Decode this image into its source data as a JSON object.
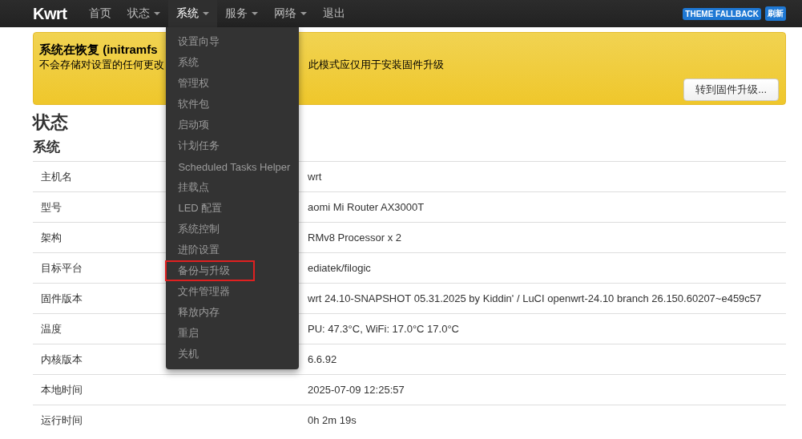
{
  "brand": "Kwrt",
  "nav": [
    {
      "label": "首页",
      "has_menu": false,
      "selected": false
    },
    {
      "label": "状态",
      "has_menu": true,
      "selected": false
    },
    {
      "label": "系统",
      "has_menu": true,
      "selected": true,
      "menu": [
        {
          "label": "设置向导",
          "highlighted": false
        },
        {
          "label": "系统",
          "highlighted": false
        },
        {
          "label": "管理权",
          "highlighted": false
        },
        {
          "label": "软件包",
          "highlighted": false
        },
        {
          "label": "启动项",
          "highlighted": false
        },
        {
          "label": "计划任务",
          "highlighted": false
        },
        {
          "label": "Scheduled Tasks Helper",
          "highlighted": false
        },
        {
          "label": "挂载点",
          "highlighted": false
        },
        {
          "label": "LED 配置",
          "highlighted": false
        },
        {
          "label": "系统控制",
          "highlighted": false
        },
        {
          "label": "进阶设置",
          "highlighted": false
        },
        {
          "label": "备份与升级",
          "highlighted": true
        },
        {
          "label": "文件管理器",
          "highlighted": false
        },
        {
          "label": "释放内存",
          "highlighted": false
        },
        {
          "label": "重启",
          "highlighted": false
        },
        {
          "label": "关机",
          "highlighted": false
        }
      ]
    },
    {
      "label": "服务",
      "has_menu": true,
      "selected": false
    },
    {
      "label": "网络",
      "has_menu": true,
      "selected": false
    },
    {
      "label": "退出",
      "has_menu": false,
      "selected": false
    }
  ],
  "badges": [
    "THEME FALLBACK",
    "刷新"
  ],
  "alert": {
    "title": "系统在恢复 (initramfs",
    "text_parts": [
      "不会存储对设置的任何更改",
      "此模式应仅用于安装固件升级"
    ],
    "button": "转到固件升级..."
  },
  "heading": "状态",
  "section": "系统",
  "table": {
    "rows": [
      {
        "key": "主机名",
        "value": "wrt"
      },
      {
        "key": "型号",
        "value": "aomi Mi Router AX3000T"
      },
      {
        "key": "架构",
        "value": "RMv8 Processor x 2"
      },
      {
        "key": "目标平台",
        "value": "ediatek/filogic"
      },
      {
        "key": "固件版本",
        "value": "wrt 24.10-SNAPSHOT 05.31.2025 by Kiddin' / LuCI openwrt-24.10 branch 26.150.60207~e459c57"
      },
      {
        "key": "温度",
        "value": "PU: 47.3°C, WiFi: 17.0°C 17.0°C"
      },
      {
        "key": "内核版本",
        "value": "6.6.92"
      },
      {
        "key": "本地时间",
        "value": "2025-07-09 12:25:57"
      },
      {
        "key": "运行时间",
        "value": "0h 2m 19s"
      }
    ]
  }
}
